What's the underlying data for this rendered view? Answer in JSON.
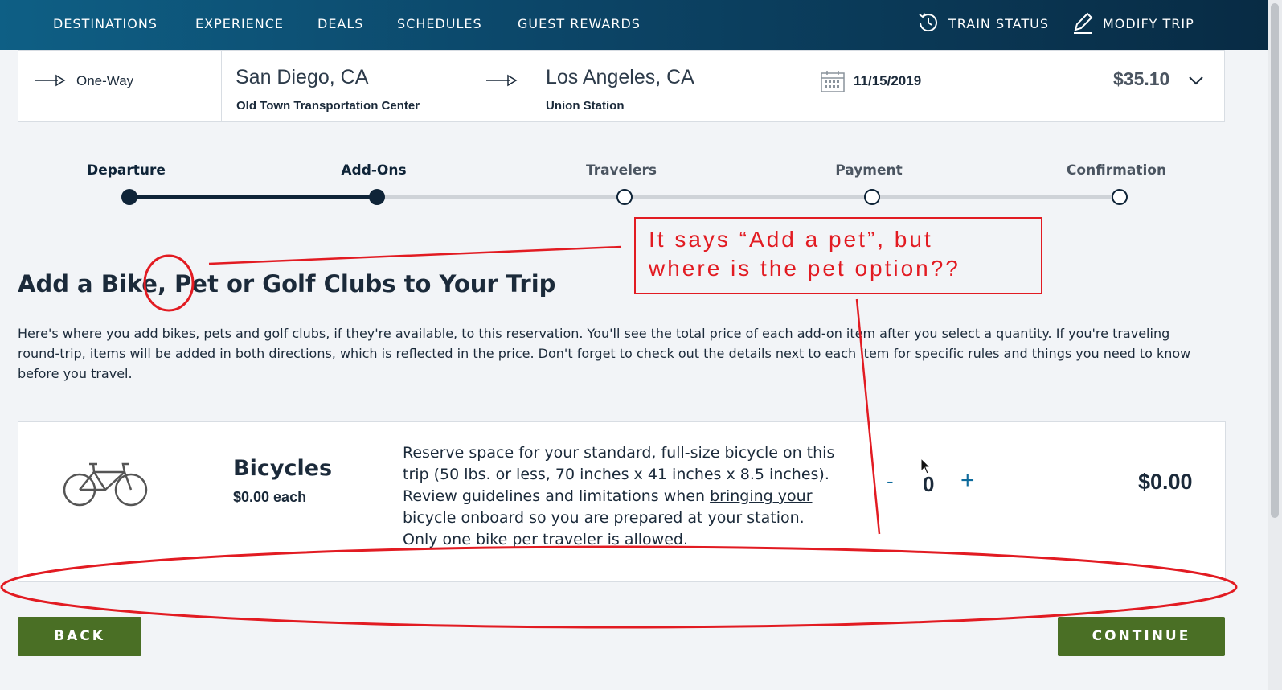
{
  "nav": {
    "items": [
      "DESTINATIONS",
      "EXPERIENCE",
      "DEALS",
      "SCHEDULES",
      "GUEST REWARDS"
    ],
    "train_status": "TRAIN STATUS",
    "modify_trip": "MODIFY TRIP"
  },
  "trip": {
    "type": "One-Way",
    "origin_city": "San Diego, CA",
    "origin_station": "Old Town Transportation Center",
    "destination_city": "Los Angeles, CA",
    "destination_station": "Union Station",
    "date": "11/15/2019",
    "price": "$35.10"
  },
  "steps": [
    {
      "label": "Departure",
      "state": "complete"
    },
    {
      "label": "Add-Ons",
      "state": "current"
    },
    {
      "label": "Travelers",
      "state": "pending"
    },
    {
      "label": "Payment",
      "state": "pending"
    },
    {
      "label": "Confirmation",
      "state": "pending"
    }
  ],
  "page": {
    "heading": "Add a Bike, Pet or Golf Clubs to Your Trip",
    "intro": "Here's where you add bikes, pets and golf clubs, if they're available, to this reservation. You'll see the total price of each add-on item after you select a quantity. If you're traveling round-trip, items will be added in both directions, which is reflected in the price. Don't forget to check out the details next to each item for specific rules and things you need to know before you travel."
  },
  "addon": {
    "name": "Bicycles",
    "unit_price": "$0.00 each",
    "desc_before": "Reserve space for your standard, full-size bicycle on this trip (50 lbs. or less, 70 inches x 41 inches x 8.5 inches). Review guidelines and limitations when ",
    "desc_link": "bringing your bicycle onboard",
    "desc_after": " so you are prepared at your station. Only one bike per traveler is allowed.",
    "minus": "-",
    "quantity": "0",
    "plus": "+",
    "total": "$0.00"
  },
  "buttons": {
    "back": "BACK",
    "continue": "CONTINUE"
  },
  "annotation": {
    "line1": "It says “Add a pet”, but",
    "line2": "where is the pet option??"
  },
  "colors": {
    "nav_gradient_start": "#0e5f85",
    "nav_gradient_end": "#082b44",
    "progress_active": "#0f2438",
    "progress_inactive": "#cfd3d8",
    "button_green": "#4a6f25",
    "annotation_red": "#e21b22"
  }
}
